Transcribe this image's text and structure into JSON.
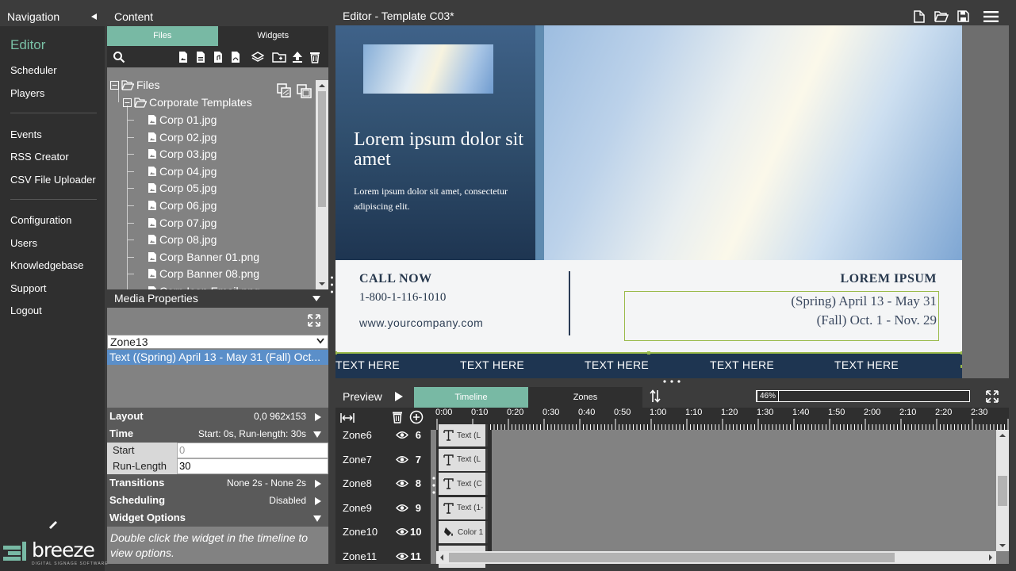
{
  "nav": {
    "title": "Navigation",
    "items": [
      {
        "label": "Editor",
        "active": true
      },
      {
        "label": "Scheduler"
      },
      {
        "label": "Players"
      },
      {
        "label": "Events"
      },
      {
        "label": "RSS Creator"
      },
      {
        "label": "CSV File Uploader"
      },
      {
        "label": "Configuration"
      },
      {
        "label": "Users"
      },
      {
        "label": "Knowledgebase"
      },
      {
        "label": "Support"
      },
      {
        "label": "Logout"
      }
    ],
    "logo_text": "breeze",
    "logo_sub": "DIGITAL SIGNAGE SOFTWARE"
  },
  "content": {
    "title": "Content",
    "tabs": [
      "Files",
      "Widgets"
    ],
    "active_tab": "Files",
    "tree": {
      "root": "Files",
      "folder": "Corporate Templates",
      "files": [
        "Corp 01.jpg",
        "Corp 02.jpg",
        "Corp 03.jpg",
        "Corp 04.jpg",
        "Corp 05.jpg",
        "Corp 06.jpg",
        "Corp 07.jpg",
        "Corp 08.jpg",
        "Corp Banner 01.png",
        "Corp Banner 08.png",
        "Corp Icon Email.png"
      ]
    }
  },
  "media_properties": {
    "title": "Media Properties",
    "zone_select": "Zone13",
    "selected_item": "Text ((Spring) April 13 - May 31 (Fall) Oct...",
    "layout_label": "Layout",
    "layout_value": "0,0  962x153",
    "time_label": "Time",
    "time_value": "Start: 0s, Run-length: 30s",
    "start_label": "Start",
    "start_value": "0",
    "runlength_label": "Run-Length",
    "runlength_value": "30",
    "transitions_label": "Transitions",
    "transitions_value": "None 2s - None 2s",
    "scheduling_label": "Scheduling",
    "scheduling_value": "Disabled",
    "widget_options_label": "Widget Options",
    "widget_hint": "Double click the widget in the timeline to view options."
  },
  "editor": {
    "title": "Editor - Template C03*",
    "canvas": {
      "headline": "Lorem ipsum dolor sit amet",
      "body": "Lorem ipsum dolor sit amet, consectetur adipiscing elit.",
      "call_now": "CALL NOW",
      "phone": "1-800-1-116-1010",
      "website": "www.yourcompany.com",
      "lorem_title": "LOREM IPSUM",
      "spring": "(Spring) April 13 - May 31",
      "fall": "(Fall) Oct. 1 - Nov. 29",
      "ticker": [
        "TEXT HERE",
        "TEXT HERE",
        "TEXT HERE",
        "TEXT HERE",
        "TEXT HERE"
      ]
    }
  },
  "timeline": {
    "preview_label": "Preview",
    "tabs": [
      "Timeline",
      "Zones"
    ],
    "active_tab": "Timeline",
    "zoom": "46%",
    "ticks": [
      "0:00",
      "0:10",
      "0:20",
      "0:30",
      "0:40",
      "0:50",
      "1:00",
      "1:10",
      "1:20",
      "1:30",
      "1:40",
      "1:50",
      "2:00",
      "2:10",
      "2:20",
      "2:30"
    ],
    "zones": [
      {
        "name": "Zone6",
        "num": "6",
        "widget": "Text (L",
        "icon": "text"
      },
      {
        "name": "Zone7",
        "num": "7",
        "widget": "Text (L",
        "icon": "text"
      },
      {
        "name": "Zone8",
        "num": "8",
        "widget": "Text (C",
        "icon": "text"
      },
      {
        "name": "Zone9",
        "num": "9",
        "widget": "Text (1-",
        "icon": "text"
      },
      {
        "name": "Zone10",
        "num": "10",
        "widget": "Color 1",
        "icon": "paint-bucket"
      },
      {
        "name": "Zone11",
        "num": "11",
        "widget": "",
        "icon": "text"
      }
    ]
  }
}
